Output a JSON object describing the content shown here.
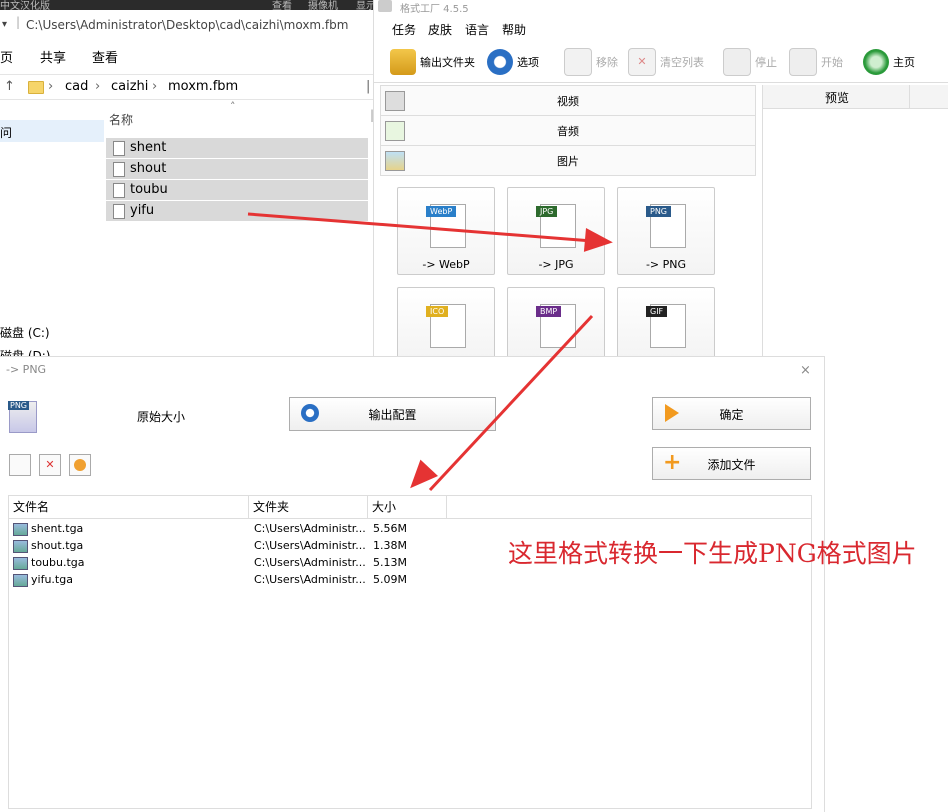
{
  "explorer": {
    "topbar": [
      "中文汉化版",
      "查看",
      "摄像机",
      "显示"
    ],
    "path": "C:\\Users\\Administrator\\Desktop\\cad\\caizhi\\moxm.fbm",
    "ribbon": [
      "页",
      "共享",
      "查看"
    ],
    "address": [
      "cad",
      "caizhi",
      "moxm.fbm"
    ],
    "nav_items": [
      "问",
      "磁盘 (C:)",
      "磁盘 (D:)"
    ],
    "column_header": "名称",
    "files": [
      "shent",
      "shout",
      "toubu",
      "yifu"
    ]
  },
  "ff": {
    "title": "格式工厂 4.5.5",
    "menu": [
      "任务",
      "皮肤",
      "语言",
      "帮助"
    ],
    "toolbar": [
      {
        "label": "输出文件夹",
        "icon": "folder-icon"
      },
      {
        "label": "选项",
        "icon": "options-icon"
      },
      {
        "label": "移除",
        "icon": "remove-icon"
      },
      {
        "label": "清空列表",
        "icon": "clear-list-icon"
      },
      {
        "label": "停止",
        "icon": "stop-icon"
      },
      {
        "label": "开始",
        "icon": "start-icon"
      },
      {
        "label": "主页",
        "icon": "home-icon"
      }
    ],
    "categories": [
      "视频",
      "音频",
      "图片"
    ],
    "preview_label": "预览",
    "tiles": [
      {
        "tag": "WebP",
        "label": "-> WebP",
        "color": "#2a7fc9"
      },
      {
        "tag": "JPG",
        "label": "-> JPG",
        "color": "#2d6a2d"
      },
      {
        "tag": "PNG",
        "label": "-> PNG",
        "color": "#2a5a8a"
      },
      {
        "tag": "ICO",
        "label": "",
        "color": "#e0b020"
      },
      {
        "tag": "BMP",
        "label": "",
        "color": "#6a2d8a"
      },
      {
        "tag": "GIF",
        "label": "",
        "color": "#222222"
      }
    ]
  },
  "dialog": {
    "title": "-> PNG",
    "close": "×",
    "format_icon_tag": "PNG",
    "size_label": "原始大小",
    "output_config": "输出配置",
    "ok": "确定",
    "add_file": "添加文件",
    "columns": [
      "文件名",
      "文件夹",
      "大小"
    ],
    "rows": [
      {
        "name": "shent.tga",
        "folder": "C:\\Users\\Administr...",
        "size": "5.56M"
      },
      {
        "name": "shout.tga",
        "folder": "C:\\Users\\Administr...",
        "size": "1.38M"
      },
      {
        "name": "toubu.tga",
        "folder": "C:\\Users\\Administr...",
        "size": "5.13M"
      },
      {
        "name": "yifu.tga",
        "folder": "C:\\Users\\Administr...",
        "size": "5.09M"
      }
    ]
  },
  "annotation": "这里格式转换一下生成PNG格式图片",
  "colors": {
    "arrow": "#e53333",
    "annotation": "#d9282f"
  }
}
